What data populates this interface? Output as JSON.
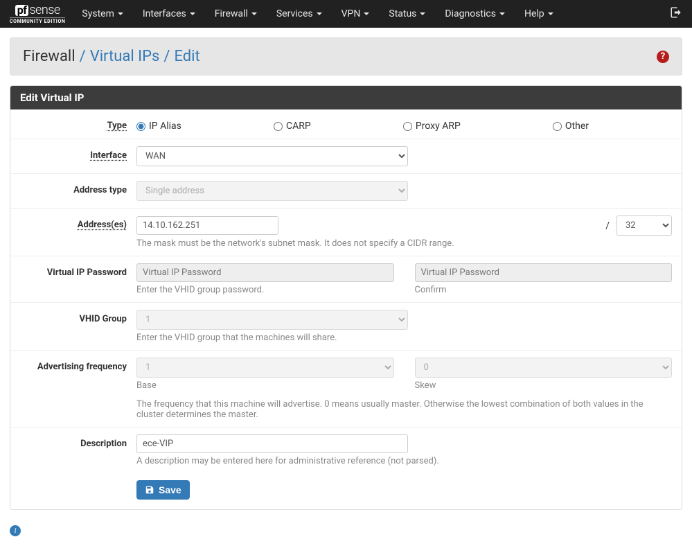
{
  "brand": {
    "pf": "pf",
    "sense": "sense",
    "sub": "COMMUNITY EDITION"
  },
  "nav": {
    "items": [
      "System",
      "Interfaces",
      "Firewall",
      "Services",
      "VPN",
      "Status",
      "Diagnostics",
      "Help"
    ]
  },
  "breadcrumb": {
    "root": "Firewall",
    "link1": "Virtual IPs",
    "link2": "Edit",
    "sep": "/"
  },
  "panel": {
    "title": "Edit Virtual IP"
  },
  "labels": {
    "type": "Type",
    "interface": "Interface",
    "address_type": "Address type",
    "addresses": "Address(es)",
    "vip_password": "Virtual IP Password",
    "vhid_group": "VHID Group",
    "adv_freq": "Advertising frequency",
    "description": "Description"
  },
  "type_options": {
    "ip_alias": "IP Alias",
    "carp": "CARP",
    "proxy_arp": "Proxy ARP",
    "other": "Other"
  },
  "interface": {
    "value": "WAN"
  },
  "address_type": {
    "value": "Single address"
  },
  "address": {
    "value": "14.10.162.251",
    "slash": "/",
    "mask": "32",
    "help": "The mask must be the network's subnet mask. It does not specify a CIDR range."
  },
  "password": {
    "placeholder1": "Virtual IP Password",
    "help1": "Enter the VHID group password.",
    "placeholder2": "Virtual IP Password",
    "help2": "Confirm"
  },
  "vhid": {
    "value": "1",
    "help": "Enter the VHID group that the machines will share."
  },
  "adv_freq": {
    "base": "1",
    "base_label": "Base",
    "skew": "0",
    "skew_label": "Skew",
    "help": "The frequency that this machine will advertise. 0 means usually master. Otherwise the lowest combination of both values in the cluster determines the master."
  },
  "description": {
    "value": "ece-VIP",
    "help": "A description may be entered here for administrative reference (not parsed)."
  },
  "buttons": {
    "save": "Save"
  },
  "help_icon": "?"
}
